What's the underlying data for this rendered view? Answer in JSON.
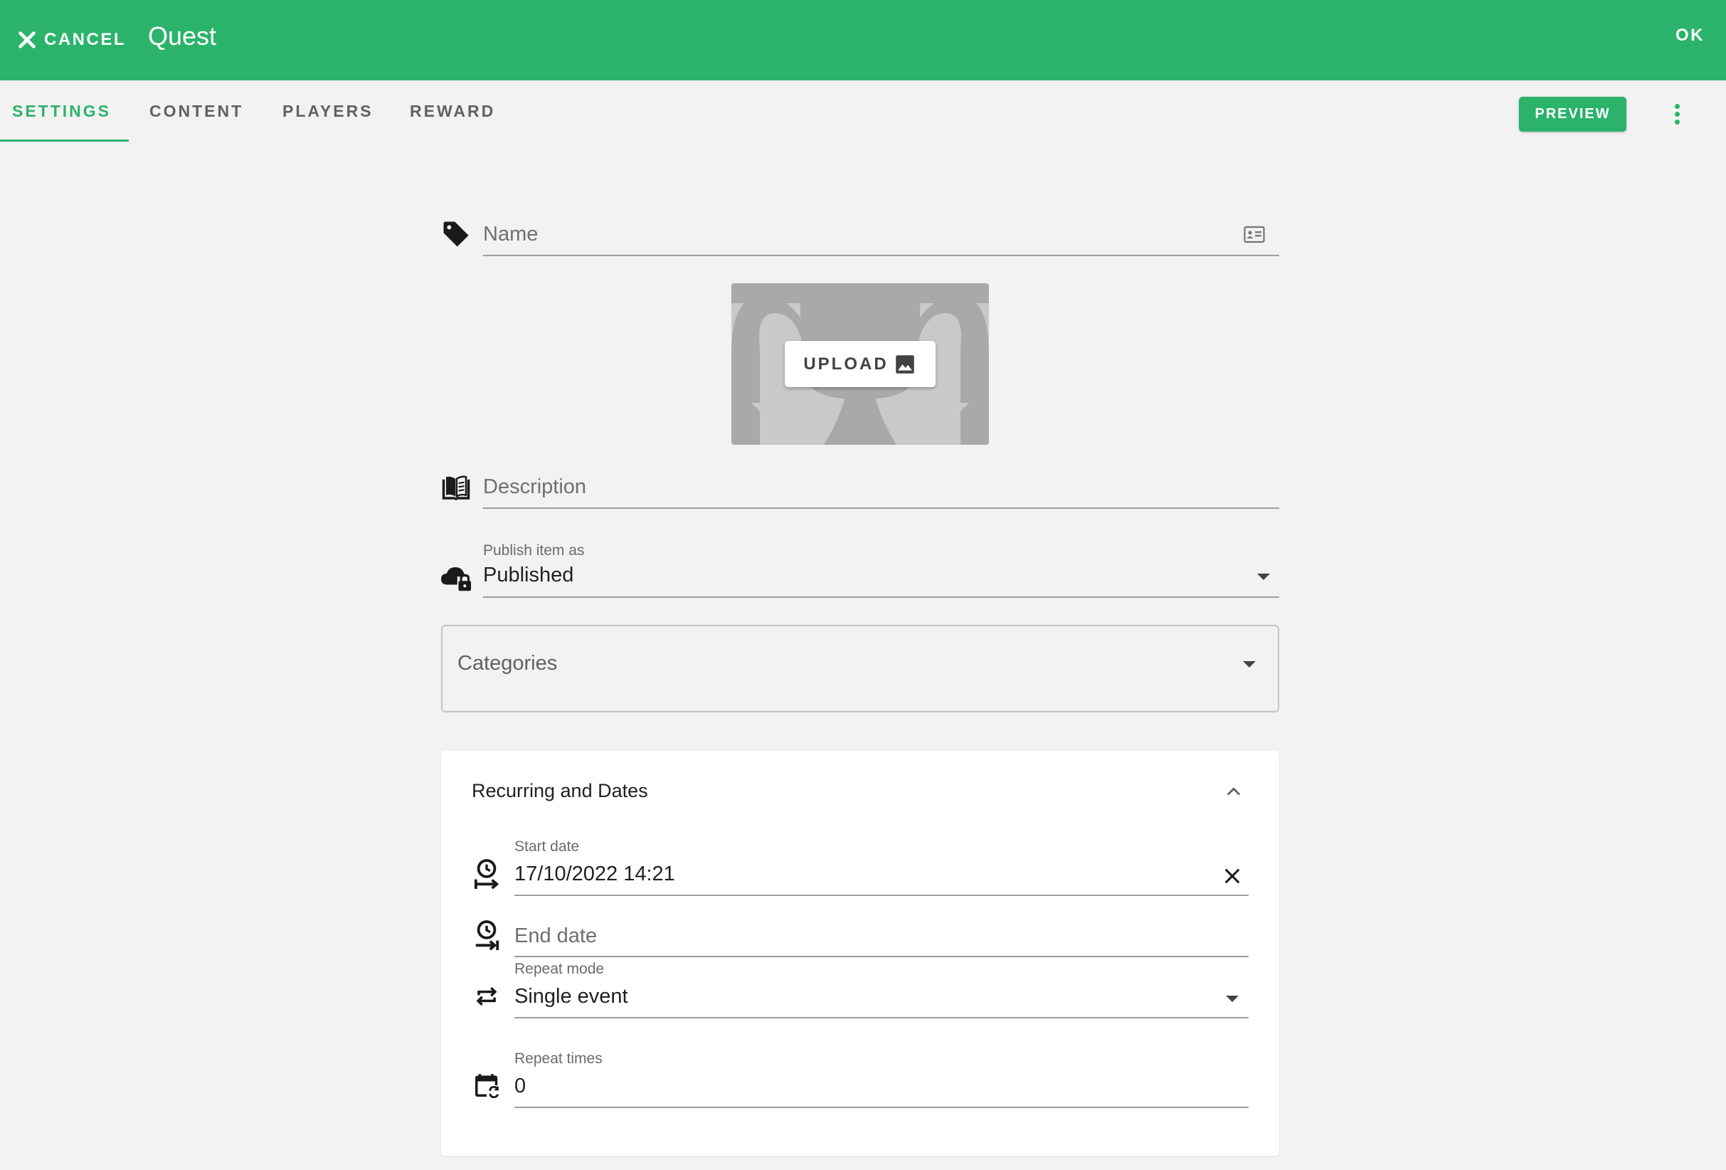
{
  "appbar": {
    "cancel_label": "CANCEL",
    "title": "Quest",
    "ok_label": "OK",
    "color": "#2bb36c"
  },
  "tabs": [
    {
      "label": "SETTINGS",
      "active": true
    },
    {
      "label": "CONTENT",
      "active": false
    },
    {
      "label": "PLAYERS",
      "active": false
    },
    {
      "label": "REWARD",
      "active": false
    }
  ],
  "toolbar": {
    "preview_label": "PREVIEW",
    "more_icon": "more-vert-icon"
  },
  "form": {
    "name": {
      "placeholder": "Name",
      "icon": "tag-icon",
      "trailing_icon": "id-card-icon"
    },
    "image": {
      "upload_label": "UPLOAD",
      "upload_icon": "image-icon",
      "placeholder_icon": "trophy-icon"
    },
    "description": {
      "placeholder": "Description",
      "icon": "book-icon"
    },
    "publish": {
      "label": "Publish item as",
      "value": "Published",
      "icon": "cloud-lock-icon"
    },
    "categories": {
      "label": "Categories"
    }
  },
  "recurring": {
    "title": "Recurring and Dates",
    "expanded": true,
    "start_date": {
      "label": "Start date",
      "value": "17/10/2022 14:21",
      "icon": "clock-start-icon",
      "clear_icon": "close-icon"
    },
    "end_date": {
      "placeholder": "End date",
      "icon": "clock-end-icon"
    },
    "repeat_mode": {
      "label": "Repeat mode",
      "value": "Single event",
      "icon": "repeat-icon"
    },
    "repeat_times": {
      "label": "Repeat times",
      "value": "0",
      "icon": "calendar-sync-icon"
    }
  }
}
